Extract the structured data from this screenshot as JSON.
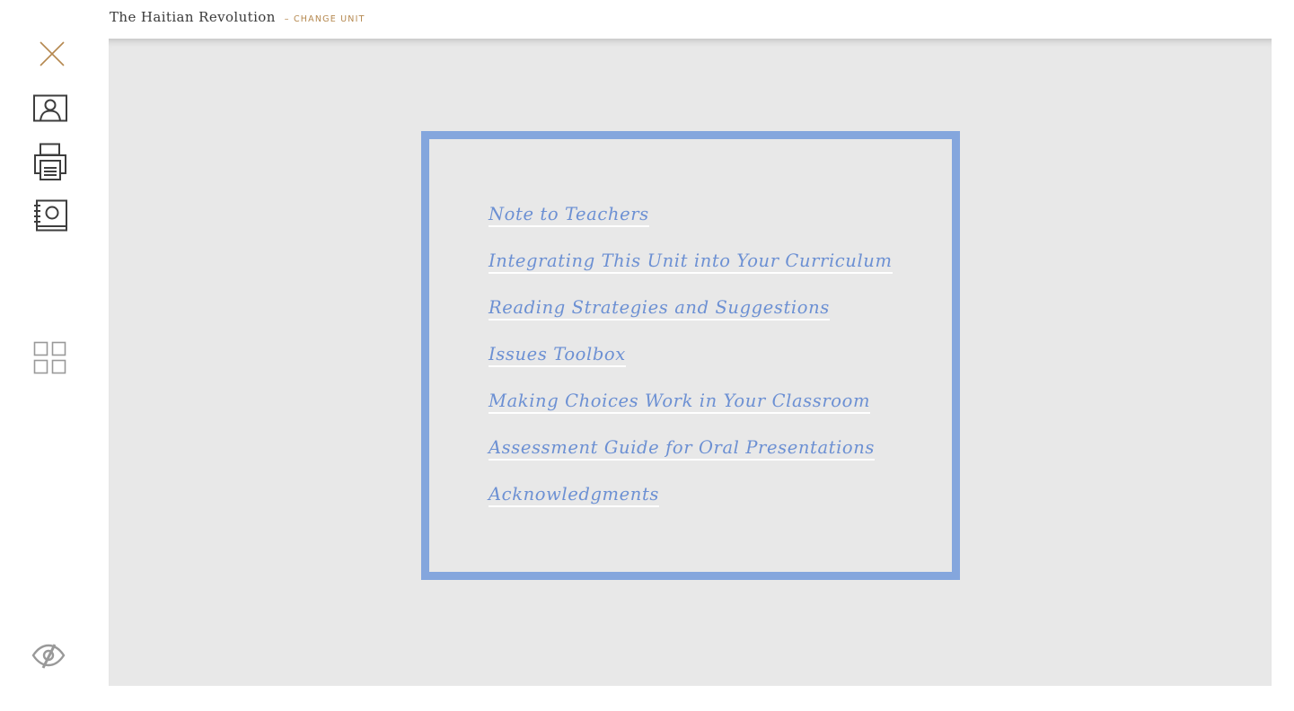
{
  "header": {
    "unit_title": "The Haitian Revolution",
    "change_unit_label": "– CHANGE UNIT"
  },
  "sidebar": {
    "icons": [
      "close-icon",
      "user-profile-icon",
      "print-icon",
      "notebook-icon",
      "grid-view-icon",
      "hide-eye-icon"
    ]
  },
  "toc": {
    "items": [
      "Note to Teachers",
      "Integrating This Unit into Your Curriculum",
      "Reading Strategies and Suggestions",
      "Issues Toolbox",
      "Making Choices Work in Your Classroom",
      "Assessment Guide for Oral Presentations",
      "Acknowledgments"
    ]
  },
  "colors": {
    "accent_gold": "#b5884f",
    "link_blue": "#6c90d3",
    "frame_blue": "#84a6dd",
    "panel_gray": "#e8e8e8",
    "icon_dark": "#3d3d3d",
    "icon_gray": "#999999"
  }
}
